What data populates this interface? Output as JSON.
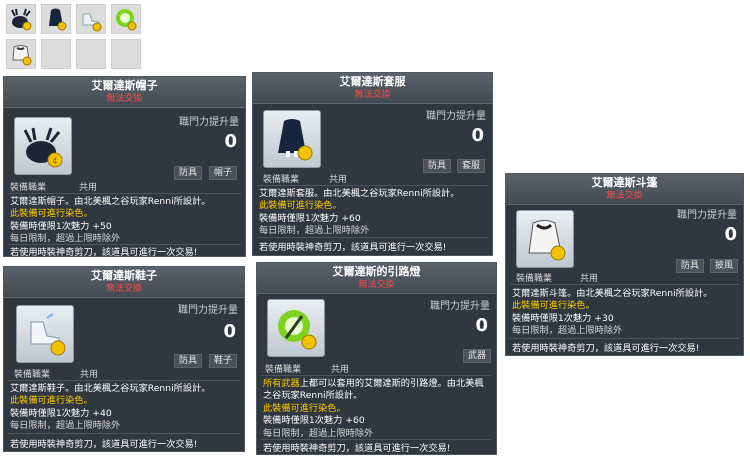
{
  "cards": {
    "hat": {
      "title": "艾爾達斯帽子",
      "untradable": "無法交換",
      "power_label": "職門力提升量",
      "power_value": "0",
      "tags": [
        "防具",
        "帽子"
      ],
      "job_label": "裝備職業",
      "job_value": "共用",
      "desc": "艾爾達斯帽子。由北美楓之谷玩家Renni所設計。",
      "dye": "此裝備可進行染色。",
      "equip_prefix": "裝備時僅限1次魅力",
      "equip_amount": "+50",
      "daily": "每日限制，超過上限時除外",
      "scissors": "若使用時裝神奇剪刀，該道具可進行一次交易!"
    },
    "suit": {
      "title": "艾爾達斯套服",
      "untradable": "無法交換",
      "power_label": "職門力提升量",
      "power_value": "0",
      "tags": [
        "防具",
        "套服"
      ],
      "job_label": "裝備職業",
      "job_value": "共用",
      "desc": "艾爾達斯套服。由北美楓之谷玩家Renni所設計。",
      "dye": "此裝備可進行染色。",
      "equip_prefix": "裝備時僅限1次魅力",
      "equip_amount": "+60",
      "daily": "每日限制，超過上限時除外",
      "scissors": "若使用時裝神奇剪刀，該道具可進行一次交易!"
    },
    "cape": {
      "title": "艾爾達斯斗篷",
      "untradable": "無法交換",
      "power_label": "職門力提升量",
      "power_value": "0",
      "tags": [
        "防具",
        "披風"
      ],
      "job_label": "裝備職業",
      "job_value": "共用",
      "desc": "艾爾達斯斗篷。由北美楓之谷玩家Renni所設計。",
      "dye": "此裝備可進行染色。",
      "equip_prefix": "裝備時僅限1次魅力",
      "equip_amount": "+30",
      "daily": "每日限制，超過上限時除外",
      "scissors": "若使用時裝神奇剪刀，該道具可進行一次交易!"
    },
    "shoes": {
      "title": "艾爾達斯鞋子",
      "untradable": "無法交換",
      "power_label": "職門力提升量",
      "power_value": "0",
      "tags": [
        "防具",
        "鞋子"
      ],
      "job_label": "裝備職業",
      "job_value": "共用",
      "desc": "艾爾達斯鞋子。由北美楓之谷玩家Renni所設計。",
      "dye": "此裝備可進行染色。",
      "equip_prefix": "裝備時僅限1次魅力",
      "equip_amount": "+40",
      "daily": "每日限制，超過上限時除外",
      "scissors": "若使用時裝神奇剪刀，該道具可進行一次交易!"
    },
    "lantern": {
      "title": "艾爾達斯的引路燈",
      "untradable": "無法交換",
      "power_label": "職門力提升量",
      "power_value": "0",
      "tags": [
        "武器"
      ],
      "job_label": "裝備職業",
      "job_value": "共用",
      "desc_hl": "所有武器",
      "desc_rest1": "上都可以套用的艾爾達斯的引路燈。由北美楓",
      "desc_rest2": "之谷玩家Renni所設計。",
      "dye": "此裝備可進行染色。",
      "equip_prefix": "裝備時僅限1次魅力",
      "equip_amount": "+60",
      "daily": "每日限制，超過上限時除外",
      "scissors": "若使用時裝神奇剪刀，該道具可進行一次交易!"
    }
  },
  "inventory": {
    "icons": [
      "hat-icon",
      "suit-icon",
      "shoes-icon",
      "lantern-icon",
      "cape-icon"
    ]
  },
  "colors": {
    "card_bg": "#2f3740",
    "untradable_red": "#ff4646",
    "dye_yellow": "#ffcc00"
  }
}
